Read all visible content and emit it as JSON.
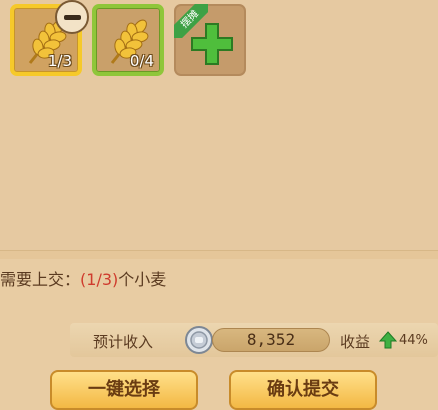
{
  "slots": [
    {
      "icon": "wheat-icon",
      "count": "1/3",
      "border": "#f6c92a",
      "removable": true
    },
    {
      "icon": "wheat-icon",
      "count": "0/4",
      "border": "#8fc63a"
    },
    {
      "icon": "plus-icon",
      "ribbon": "摆摊"
    }
  ],
  "requirement": {
    "prefix": "需要上交：",
    "fraction": "(1/3)",
    "suffix": "个小麦"
  },
  "income": {
    "label": "预计收入",
    "coin_icon": "silver-coin-icon",
    "amount": "8,352",
    "profit_label": "收益",
    "trend_icon": "green-up-arrow-icon",
    "profit_pct": "44%"
  },
  "buttons": {
    "one_key_select": "一键选择",
    "confirm_submit": "确认提交"
  },
  "colors": {
    "accent_red": "#cf3b2d",
    "gold": "#f3b844",
    "green": "#3ea145"
  }
}
